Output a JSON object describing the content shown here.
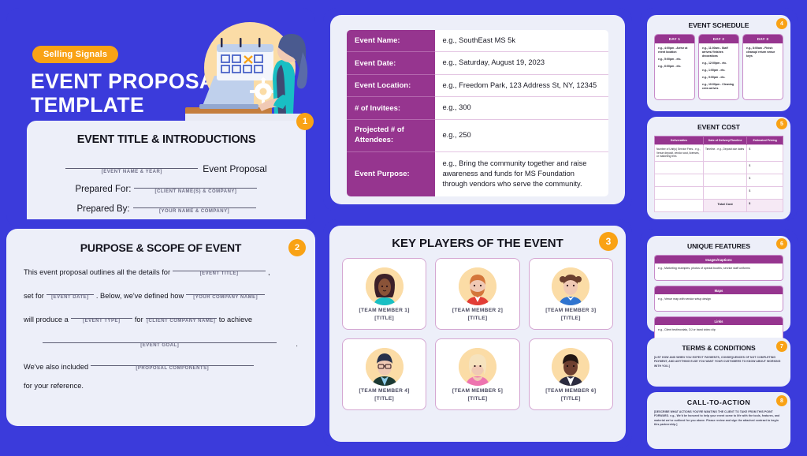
{
  "theme": {
    "blue": "#3B3BDB",
    "orange": "#F9A215",
    "purple": "#96358F",
    "panel": "#EDEFF9"
  },
  "hero": {
    "brand_pill": "Selling Signals",
    "title_line1": "EVENT PROPOSAL",
    "title_line2": "TEMPLATE",
    "illustration": "woman-at-laptop-with-calendar-illustration"
  },
  "section1": {
    "badge": "1",
    "title": "EVENT TITLE & INTRODUCTIONS",
    "proposal_suffix": "Event Proposal",
    "hint_event_name": "[EVENT NAME & YEAR]",
    "prepared_for_label": "Prepared For:",
    "hint_prepared_for": "[CLIENT NAME(S) & COMPANY]",
    "prepared_by_label": "Prepared By:",
    "hint_prepared_by": "[YOUR NAME & COMPANY]"
  },
  "section2": {
    "badge": "2",
    "title": "PURPOSE & SCOPE OF EVENT",
    "t1": "This event proposal outlines all the details for",
    "h1": "[EVENT TITLE]",
    "t2": "set for",
    "h2": "[EVENT DATE]",
    "t3": ". Below, we've defined how",
    "h3": "[YOUR COMPANY NAME]",
    "t4": "will produce a",
    "h4": "[EVENT TYPE]",
    "t5": "for",
    "h5": "[CLIENT COMPANY NAME]",
    "t6": "to achieve",
    "h6": "[EVENT GOAL]",
    "t7": "We've also included",
    "h7": "[PROPOSAL COMPONENTS]",
    "t8": "for your reference."
  },
  "event_details": {
    "rows": [
      {
        "key": "Event Name:",
        "value": "e.g., SouthEast MS 5k"
      },
      {
        "key": "Event Date:",
        "value": "e.g., Saturday, August 19, 2023"
      },
      {
        "key": "Event Location:",
        "value": "e.g., Freedom Park, 123 Address St, NY, 12345"
      },
      {
        "key": "# of Invitees:",
        "value": "e.g., 300"
      },
      {
        "key": "Projected # of Attendees:",
        "value": "e.g., 250"
      },
      {
        "key": "Event Purpose:",
        "value": "e.g., Bring the community together and raise awareness and funds for MS Foundation through vendors who serve the community."
      }
    ]
  },
  "key_players": {
    "badge": "3",
    "title": "KEY PLAYERS OF THE EVENT",
    "members": [
      {
        "name": "[TEAM MEMBER 1]",
        "title": "[TITLE]",
        "avatar": "avatar-woman-dark-hair"
      },
      {
        "name": "[TEAM MEMBER 2]",
        "title": "[TITLE]",
        "avatar": "avatar-man-beard-red-shirt"
      },
      {
        "name": "[TEAM MEMBER 3]",
        "title": "[TITLE]",
        "avatar": "avatar-woman-buns-blue-collar"
      },
      {
        "name": "[TEAM MEMBER 4]",
        "title": "[TITLE]",
        "avatar": "avatar-man-glasses-green-jacket"
      },
      {
        "name": "[TEAM MEMBER 5]",
        "title": "[TITLE]",
        "avatar": "avatar-woman-blonde-pink-top"
      },
      {
        "name": "[TEAM MEMBER 6]",
        "title": "[TITLE]",
        "avatar": "avatar-man-dark-suit"
      }
    ]
  },
  "schedule": {
    "badge": "4",
    "title": "EVENT SCHEDULE",
    "days": [
      {
        "head": "DAY 1",
        "items": [
          "e.g., 4:00pm - Arrive at event location",
          "e.g., 5:00pm - etc.",
          "e.g., 6:00pm - etc."
        ]
      },
      {
        "head": "DAY 2",
        "items": [
          "e.g., 11:00am - Staff arrives/ finishes decorations",
          "e.g., 12:00pm - etc.",
          "e.g., 1:00pm - etc.",
          "e.g., 9:00pm - etc.",
          "e.g., 10:00pm - Cleaning crew arrives"
        ]
      },
      {
        "head": "DAY 3",
        "items": [
          "e.g., 8:00am - Finish cleanup/ return venue keys"
        ]
      }
    ]
  },
  "event_cost": {
    "badge": "5",
    "title": "EVENT COST",
    "headers": [
      "Deliverables",
      "Date of Delivery/Timeline",
      "Estimated Pricing"
    ],
    "rows": [
      {
        "deliverable": "Number of Unit(s) Service Fees - e.g., Venue deposit, vendor cost, licenses, or marketing fees",
        "date": "Timeline - e.g., Deposit due dates",
        "price": "$"
      },
      {
        "deliverable": "",
        "date": "",
        "price": "$"
      },
      {
        "deliverable": "",
        "date": "",
        "price": "$"
      },
      {
        "deliverable": "",
        "date": "",
        "price": "$"
      }
    ],
    "total_label": "Total Cost",
    "total_value": "$"
  },
  "unique_features": {
    "badge": "6",
    "title": "UNIQUE FEATURES",
    "blocks": [
      {
        "head": "Images/Captions",
        "body": "e.g., Marketing examples, photos of special booths, service staff uniforms"
      },
      {
        "head": "Maps",
        "body": "e.g., Venue map with vendor setup design"
      },
      {
        "head": "Links",
        "body": "e.g., Client testimonials, DJ or band video clip"
      }
    ]
  },
  "terms": {
    "badge": "7",
    "title": "TERMS & CONDITIONS",
    "body": "[LIST HOW AND WHEN YOU EXPECT PAYMENTS, CONSEQUENCES OF NOT COMPLETING PAYMENT, AND ANYTHING ELSE YOU WANT YOUR CUSTOMERS TO KNOW ABOUT WORKING WITH YOU.]"
  },
  "cta": {
    "badge": "8",
    "title": "CALL-TO-ACTION",
    "body": "[DESCRIBE WHAT ACTIONS YOU'RE WANTING THE CLIENT TO TAKE FROM THIS POINT FORWARD. e.g., We'd be honored to help your event come to life with the tools, features, and material we've outlined for you above. Please review and sign the attached contract to begin this partnership.]"
  }
}
